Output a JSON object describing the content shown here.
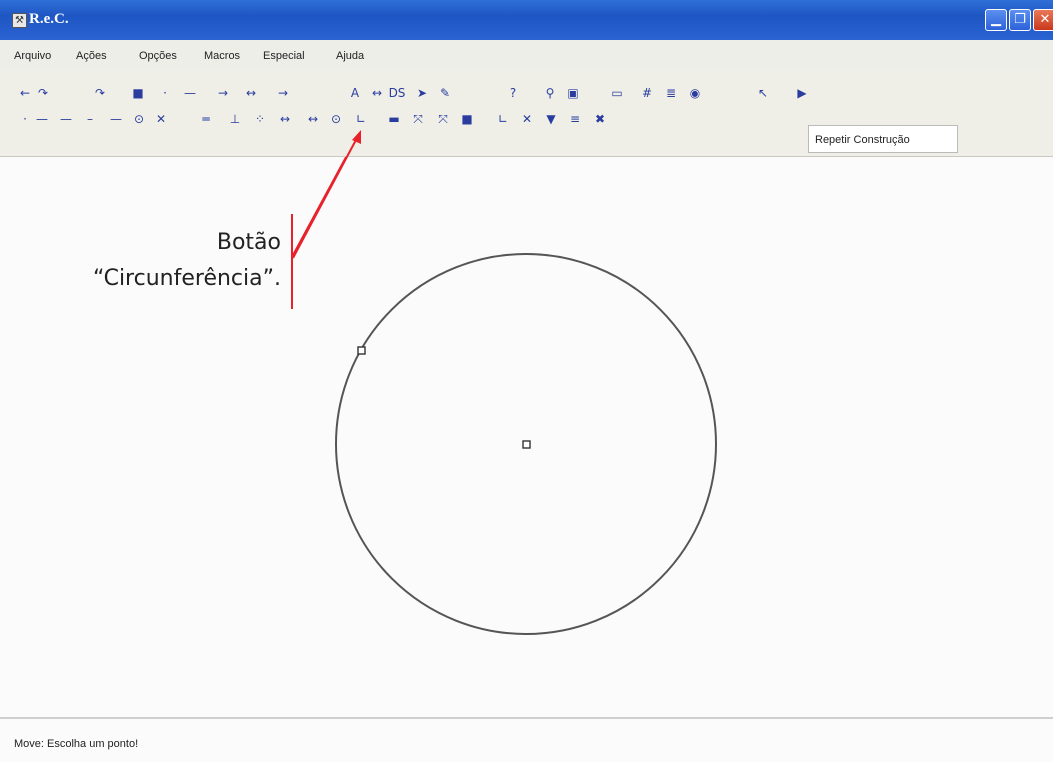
{
  "window": {
    "title": "R.e.C.",
    "icon": "compass-app-icon"
  },
  "menu": [
    "Arquivo",
    "Ações",
    "Opções",
    "Macros",
    "Especial",
    "Ajuda"
  ],
  "toolbar": {
    "row1": [
      {
        "name": "undo-icon",
        "glyph": "←"
      },
      {
        "name": "redo-icon",
        "glyph": "↷"
      },
      {
        "name": "redo-arrow-icon",
        "glyph": "↷"
      },
      {
        "name": "fill-color-icon",
        "glyph": "■"
      },
      {
        "name": "point-icon",
        "glyph": "·"
      },
      {
        "name": "line-style-icon",
        "glyph": "—"
      },
      {
        "name": "vector-icon",
        "glyph": "→"
      },
      {
        "name": "segment-style-icon",
        "glyph": "↔"
      },
      {
        "name": "ray-icon",
        "glyph": "→"
      },
      {
        "name": "text-icon",
        "glyph": "A"
      },
      {
        "name": "measure-icon",
        "glyph": "↔"
      },
      {
        "name": "label-icon",
        "glyph": "DS"
      },
      {
        "name": "animate-icon",
        "glyph": "➤"
      },
      {
        "name": "trace-icon",
        "glyph": "✎"
      },
      {
        "name": "help-icon",
        "glyph": "?"
      },
      {
        "name": "zoom-icon",
        "glyph": "⚲"
      },
      {
        "name": "color-palette-icon",
        "glyph": "▣"
      },
      {
        "name": "window-icon",
        "glyph": "▭"
      },
      {
        "name": "grid-icon",
        "glyph": "#"
      },
      {
        "name": "list-icon",
        "glyph": "≣"
      },
      {
        "name": "camera-icon",
        "glyph": "◉"
      },
      {
        "name": "pointer-icon",
        "glyph": "↖"
      },
      {
        "name": "play-icon",
        "glyph": "▶"
      }
    ],
    "row2": [
      {
        "name": "point-tool-icon",
        "glyph": "·"
      },
      {
        "name": "line-tool-icon",
        "glyph": "—"
      },
      {
        "name": "segment-tool-icon",
        "glyph": "—"
      },
      {
        "name": "short-segment-icon",
        "glyph": "–"
      },
      {
        "name": "ray-tool-icon",
        "glyph": "—"
      },
      {
        "name": "circle-tool-icon",
        "glyph": "⊙"
      },
      {
        "name": "intersection-icon",
        "glyph": "✕"
      },
      {
        "name": "parallel-icon",
        "glyph": "═"
      },
      {
        "name": "perpendicular-icon",
        "glyph": "⊥"
      },
      {
        "name": "midpoint-icon",
        "glyph": "⁘"
      },
      {
        "name": "compass-icon",
        "glyph": "↔"
      },
      {
        "name": "bisector-icon",
        "glyph": "↔"
      },
      {
        "name": "circle-center-icon",
        "glyph": "⊙"
      },
      {
        "name": "angle-icon",
        "glyph": "∟"
      },
      {
        "name": "polygon-icon",
        "glyph": "▬"
      },
      {
        "name": "reflect-icon",
        "glyph": "⤧"
      },
      {
        "name": "rotate-icon",
        "glyph": "⤧"
      },
      {
        "name": "fill-tool-icon",
        "glyph": "■"
      },
      {
        "name": "angle-measure-icon",
        "glyph": "∟"
      },
      {
        "name": "delete-icon",
        "glyph": "✕"
      },
      {
        "name": "hide-icon",
        "glyph": "▼"
      },
      {
        "name": "format-icon",
        "glyph": "≡"
      },
      {
        "name": "erase-icon",
        "glyph": "✖"
      }
    ],
    "tooltip": "Repetir Construção"
  },
  "annotation": {
    "line1": "Botão",
    "line2": "“Circunferência”."
  },
  "status": "Move: Escolha um ponto!"
}
